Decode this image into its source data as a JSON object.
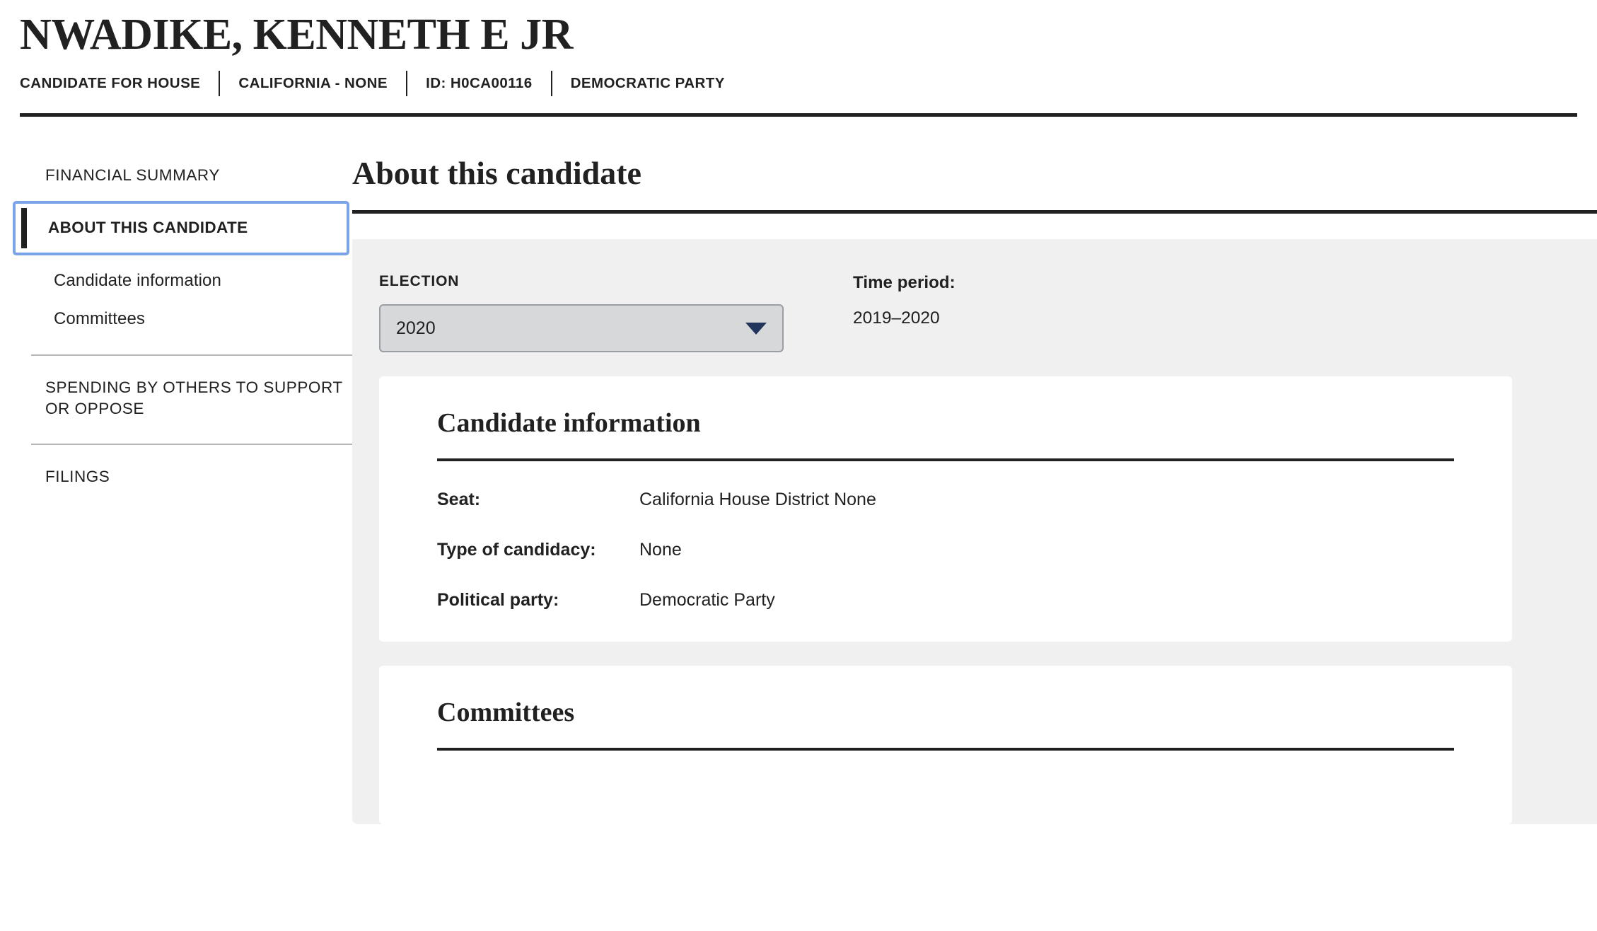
{
  "header": {
    "candidate_name": "NWADIKE, KENNETH E JR",
    "meta": [
      "CANDIDATE FOR HOUSE",
      "CALIFORNIA - NONE",
      "ID: H0CA00116",
      "DEMOCRATIC PARTY"
    ]
  },
  "sidebar": {
    "items": [
      {
        "label": "FINANCIAL SUMMARY",
        "type": "link",
        "active": false
      },
      {
        "label": "ABOUT THIS CANDIDATE",
        "type": "link",
        "active": true
      },
      {
        "label": "Candidate information",
        "type": "subitem",
        "active": false
      },
      {
        "label": "Committees",
        "type": "subitem",
        "active": false
      },
      {
        "label": "SPENDING BY OTHERS TO SUPPORT OR OPPOSE",
        "type": "link",
        "active": false
      },
      {
        "label": "FILINGS",
        "type": "link",
        "active": false
      }
    ]
  },
  "main": {
    "title": "About this candidate",
    "election": {
      "label": "ELECTION",
      "selected": "2020",
      "caret_icon": "chevron-down-icon"
    },
    "time_period": {
      "label": "Time period:",
      "value": "2019–2020"
    },
    "candidate_information": {
      "title": "Candidate information",
      "rows": [
        {
          "label": "Seat:",
          "value": "California House District None"
        },
        {
          "label": "Type of candidacy:",
          "value": "None"
        },
        {
          "label": "Political party:",
          "value": "Democratic Party"
        }
      ]
    },
    "committees": {
      "title": "Committees"
    }
  },
  "colors": {
    "text": "#212121",
    "focus_ring": "#7ba3e8",
    "panel_background": "#f0f0f0",
    "select_background": "#d6d8da",
    "select_border": "#9b9fa3",
    "caret": "#21345c"
  }
}
